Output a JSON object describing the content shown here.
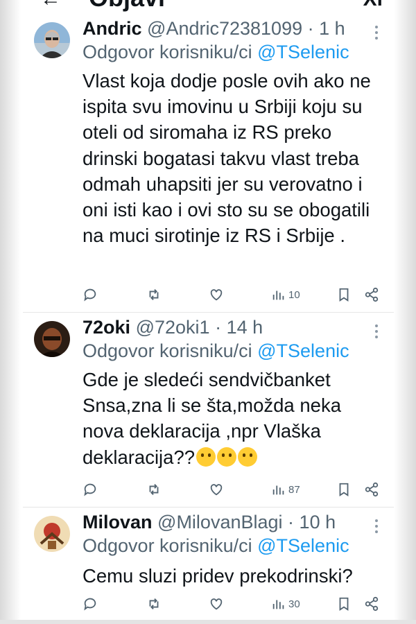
{
  "header": {
    "title": "Objavi",
    "back_glyph": "←",
    "close_glyph": "Xi"
  },
  "tweets": [
    {
      "name": "Andric",
      "handle": "@Andric72381099",
      "sep": "·",
      "time": "1 h",
      "reply_prefix": "Odgovor korisniku/ci",
      "reply_mention": "@TSelenic",
      "body": "Vlast koja dodje posle ovih ako ne ispita svu imovinu u Srbiji koju su oteli od siromaha iz RS preko drinski bogatasi takvu vlast treba odmah uhapsiti jer su verovatno i oni isti kao i ovi sto su se obogatili na muci sirotinje iz RS i Srbije .",
      "views": "10",
      "avatar_color": "#7fa7c9"
    },
    {
      "name": "72oki",
      "handle": "@72oki1",
      "sep": "·",
      "time": "14 h",
      "reply_prefix": "Odgovor korisniku/ci",
      "reply_mention": "@TSelenic",
      "body": "Gde je sledeći sendvičbanket Snsa,zna li se šta,možda neka nova deklaracija ,npr Vlaška deklaracija??",
      "emojis": [
        "thinking-face-emoji",
        "grinning-face-emoji",
        "rolling-laughing-emoji"
      ],
      "views": "87",
      "avatar_color": "#3a2a1e"
    },
    {
      "name": "Milovan",
      "handle": "@MilovanBlagi",
      "sep": "·",
      "time": "10 h",
      "reply_prefix": "Odgovor korisniku/ci",
      "reply_mention": "@TSelenic",
      "body": "Cemu sluzi pridev prekodrinski?",
      "views": "30",
      "avatar_color": "#e8c48a"
    }
  ],
  "icons": {
    "reply": "reply-icon",
    "retweet": "retweet-icon",
    "like": "like-icon",
    "views": "views-icon",
    "bookmark": "bookmark-icon",
    "share": "share-icon",
    "more": "more-vertical-icon"
  },
  "colors": {
    "link": "#1d9bf0",
    "muted": "#536471",
    "text": "#0f1419"
  }
}
